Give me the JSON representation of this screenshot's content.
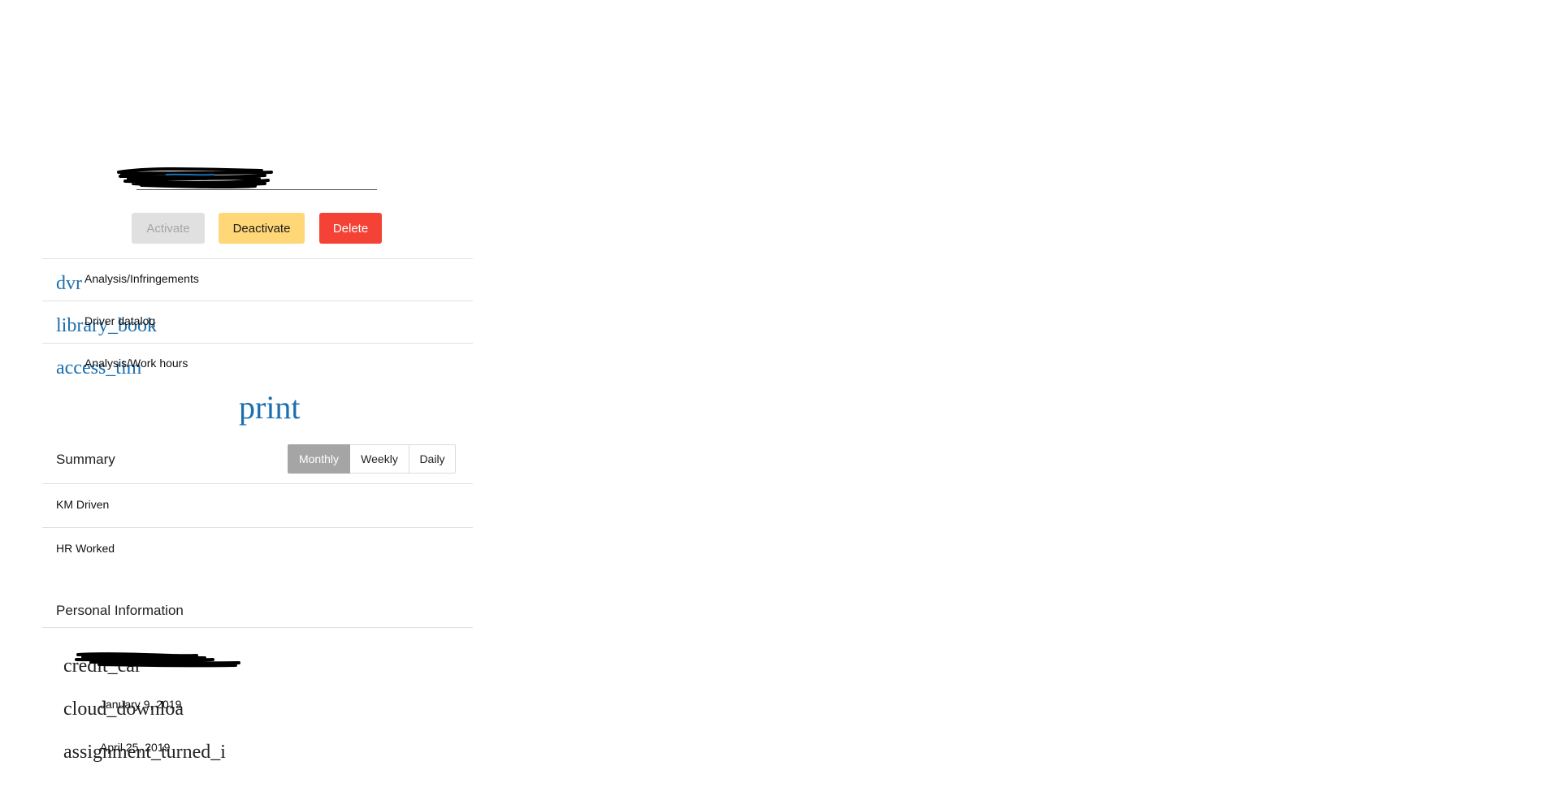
{
  "profile": {
    "name": ""
  },
  "actions": {
    "activate_label": "Activate",
    "deactivate_label": "Deactivate",
    "delete_label": "Delete"
  },
  "nav": {
    "items": [
      {
        "icon": "dvr",
        "label": "Analysis/Infringements"
      },
      {
        "icon": "library_book",
        "label": "Driver dataloq"
      },
      {
        "icon": "access_tim",
        "label": "Analysis/Work hours"
      }
    ]
  },
  "print_icon": "print",
  "summary": {
    "title": "Summary",
    "periods": [
      "Monthly",
      "Weekly",
      "Daily"
    ],
    "selected_period": "Monthly",
    "rows": [
      "KM Driven",
      "HR Worked"
    ]
  },
  "personal_info": {
    "title": "Personal Information",
    "rows": [
      {
        "icon": "credit_car",
        "value": ""
      },
      {
        "icon": "cloud_downloa",
        "value": "January 9, 2019"
      },
      {
        "icon": "assignment_turned_i",
        "value": "April 25, 2019"
      }
    ]
  },
  "colors": {
    "accent_icon": "#1b6fb0",
    "deactivate": "#ffd777",
    "delete": "#f44336",
    "activate_disabled": "#e0e0e0",
    "segment_selected": "#a5a5a5"
  }
}
